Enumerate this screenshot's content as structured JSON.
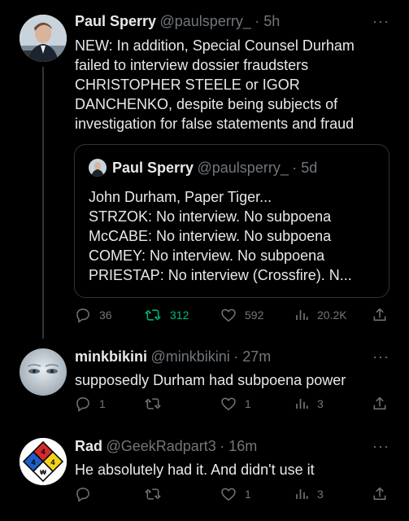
{
  "tweets": [
    {
      "name": "Paul Sperry",
      "handle": "@paulsperry_",
      "time": "· 5h",
      "more": "···",
      "text": "NEW: In addition, Special Counsel Durham failed to interview dossier fraudsters CHRISTOPHER STEELE or IGOR DANCHENKO, despite being subjects of investigation for false statements and fraud",
      "quote": {
        "name": "Paul Sperry",
        "handle": "@paulsperry_",
        "time": "· 5d",
        "lines": [
          "John Durham, Paper Tiger...",
          "STRZOK: No interview. No subpoena",
          "McCABE: No interview. No subpoena",
          "COMEY: No interview. No subpoena",
          "PRIESTAP: No interview (Crossfire). N..."
        ]
      },
      "replies": "36",
      "retweets": "312",
      "likes": "592",
      "views": "20.2K"
    },
    {
      "name": "minkbikini",
      "handle": "@minkbikini",
      "time": "· 27m",
      "more": "···",
      "text": "supposedly Durham had subpoena power",
      "replies": "1",
      "retweets": "",
      "likes": "1",
      "views": "3"
    },
    {
      "name": "Rad",
      "handle": "@GeekRadpart3",
      "time": "· 16m",
      "more": "···",
      "text": "He absolutely had it. And didn't use it",
      "replies": "",
      "retweets": "",
      "likes": "1",
      "views": "3"
    }
  ],
  "colors": {
    "background": "#000000",
    "text": "#e7e9ea",
    "muted": "#71767b",
    "retweet_active": "#00ba7c",
    "border": "#2f3336"
  }
}
